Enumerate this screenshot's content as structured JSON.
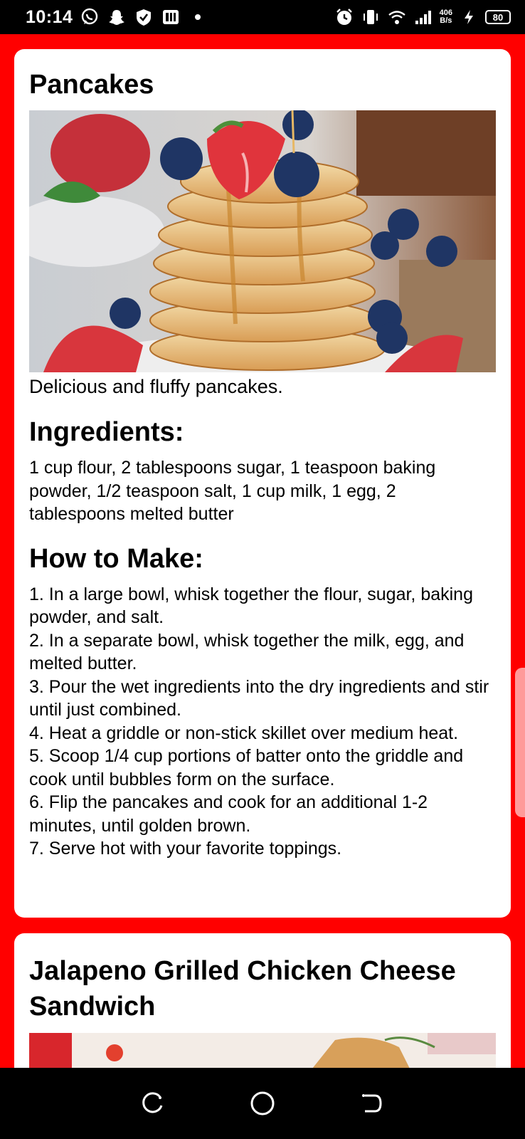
{
  "status_bar": {
    "time": "10:14",
    "net_speed_value": "406",
    "net_speed_unit": "B/s",
    "battery": "80",
    "icons": [
      "whatsapp-icon",
      "snapchat-icon",
      "shield-icon",
      "app-icon",
      "dot-icon",
      "alarm-icon",
      "vibrate-icon",
      "wifi-icon",
      "signal-icon",
      "charging-icon"
    ]
  },
  "recipes": [
    {
      "title": "Pancakes",
      "image": "pancake-stack-photo",
      "description": "Delicious and fluffy pancakes.",
      "ingredients_heading": "Ingredients:",
      "ingredients": "1 cup flour, 2 tablespoons sugar, 1 teaspoon baking powder, 1/2 teaspoon salt, 1 cup milk, 1 egg, 2 tablespoons melted butter",
      "steps_heading": "How to Make:",
      "steps": [
        "1. In a large bowl, whisk together the flour, sugar, baking powder, and salt.",
        "2. In a separate bowl, whisk together the milk, egg, and melted butter.",
        "3. Pour the wet ingredients into the dry ingredients and stir until just combined.",
        "4. Heat a griddle or non-stick skillet over medium heat.",
        "5. Scoop 1/4 cup portions of batter onto the griddle and cook until bubbles form on the surface.",
        "6. Flip the pancakes and cook for an additional 1-2 minutes, until golden brown.",
        "7. Serve hot with your favorite toppings."
      ]
    },
    {
      "title": "Jalapeno Grilled Chicken Cheese Sandwich",
      "image": "sandwich-photo"
    }
  ],
  "nav": {
    "recents": "recents-icon",
    "home": "home-icon",
    "back": "back-icon"
  },
  "colors": {
    "background": "#ff0000",
    "card": "#ffffff",
    "bars": "#000000"
  }
}
